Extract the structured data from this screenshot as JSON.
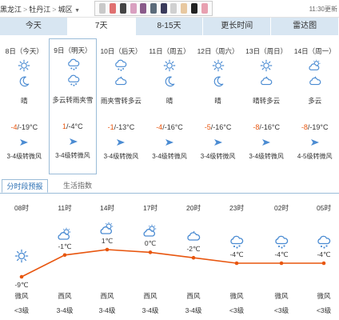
{
  "breadcrumb": {
    "items": [
      "黑龙江",
      "牡丹江",
      "城区"
    ],
    "sep": ">"
  },
  "update_time": "11:30更新",
  "tabs": [
    {
      "label": "今天"
    },
    {
      "label": "7天"
    },
    {
      "label": "8-15天"
    },
    {
      "label": "更长时间"
    },
    {
      "label": "雷达图"
    }
  ],
  "active_tab": "7天",
  "colors": {
    "accent": "#e8560f",
    "tab_bg": "#d8e6f2",
    "icon_blue": "#4a8bd2",
    "border_blue": "#9bbcd8"
  },
  "days": [
    {
      "date": "8日（今天）",
      "icon_day": "sun-icon",
      "icon_night": "moon-icon",
      "desc": "晴",
      "high": "-4",
      "low": "/-19°C",
      "wind": "3-4级转微风"
    },
    {
      "date": "9日（明天）",
      "icon_day": "cloud-snow-icon",
      "icon_night": "cloud-snow-icon",
      "desc": "多云转雨夹雪",
      "high": "1",
      "low": "/-4°C",
      "wind": "3-4级转微风"
    },
    {
      "date": "10日（后天）",
      "icon_day": "cloud-snow-icon",
      "icon_night": "cloud-night-icon",
      "desc": "雨夹雪转多云",
      "high": "-1",
      "low": "/-13°C",
      "wind": "3-4级转微风"
    },
    {
      "date": "11日（周五）",
      "icon_day": "sun-icon",
      "icon_night": "moon-icon",
      "desc": "晴",
      "high": "-4",
      "low": "/-16°C",
      "wind": "3-4级转微风"
    },
    {
      "date": "12日（周六）",
      "icon_day": "sun-icon",
      "icon_night": "moon-icon",
      "desc": "晴",
      "high": "-5",
      "low": "/-16°C",
      "wind": "3-4级转微风"
    },
    {
      "date": "13日（周日）",
      "icon_day": "sun-icon",
      "icon_night": "cloud-night-icon",
      "desc": "晴转多云",
      "high": "-8",
      "low": "/-16°C",
      "wind": "3-4级转微风"
    },
    {
      "date": "14日（周一）",
      "icon_day": "partly-cloudy-icon",
      "icon_night": "cloud-night-icon",
      "desc": "多云",
      "high": "-8",
      "low": "/-19°C",
      "wind": "4-5级转微风"
    }
  ],
  "selected_day_index": 1,
  "subtabs": {
    "active": "分时段预报",
    "other": "生活指数"
  },
  "hourly": [
    {
      "time": "08时",
      "icon": "sun-icon",
      "temp": "-9℃",
      "temp_value": -9,
      "wind_dir": "微风",
      "wind_level": "<3级"
    },
    {
      "time": "11时",
      "icon": "partly-cloudy-icon",
      "temp": "-1℃",
      "temp_value": -1,
      "wind_dir": "西风",
      "wind_level": "3-4级"
    },
    {
      "time": "14时",
      "icon": "partly-cloudy-icon",
      "temp": "1℃",
      "temp_value": 1,
      "wind_dir": "西风",
      "wind_level": "3-4级"
    },
    {
      "time": "17时",
      "icon": "partly-cloudy-icon",
      "temp": "0℃",
      "temp_value": 0,
      "wind_dir": "西风",
      "wind_level": "3-4级"
    },
    {
      "time": "20时",
      "icon": "cloud-night-icon",
      "temp": "-2℃",
      "temp_value": -2,
      "wind_dir": "西风",
      "wind_level": "3-4级"
    },
    {
      "time": "23时",
      "icon": "cloud-snow-icon",
      "temp": "-4℃",
      "temp_value": -4,
      "wind_dir": "微风",
      "wind_level": "<3级"
    },
    {
      "time": "02时",
      "icon": "cloud-snow-icon",
      "temp": "-4℃",
      "temp_value": -4,
      "wind_dir": "微风",
      "wind_level": "<3级"
    },
    {
      "time": "05时",
      "icon": "cloud-snow-icon",
      "temp": "-4℃",
      "temp_value": -4,
      "wind_dir": "微风",
      "wind_level": "<3级"
    }
  ]
}
